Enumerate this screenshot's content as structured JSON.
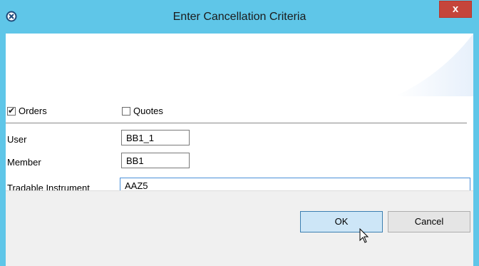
{
  "window": {
    "title": "Enter Cancellation Criteria",
    "close_label": "x",
    "app_icon": "app-icon",
    "accent": "#5fc6e8"
  },
  "filters": {
    "orders": {
      "label": "Orders",
      "checked": true
    },
    "quotes": {
      "label": "Quotes",
      "checked": false
    }
  },
  "fields": {
    "user": {
      "label": "User",
      "value": "BB1_1"
    },
    "member": {
      "label": "Member",
      "value": "BB1"
    },
    "tradable_instrument": {
      "label": "Tradable Instrument",
      "value": "AAZ5"
    }
  },
  "buttons": {
    "ok_label": "OK",
    "cancel_label": "Cancel"
  }
}
